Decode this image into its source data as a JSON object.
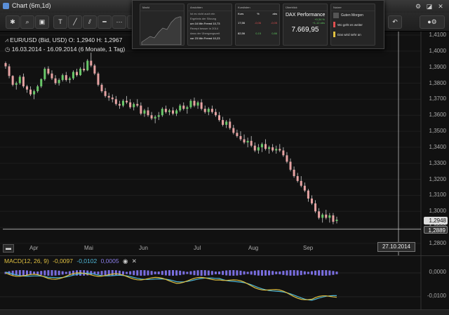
{
  "window": {
    "title": "Chart (6m,1d)"
  },
  "toolbar": {
    "buttons": [
      "settings",
      "search",
      "zoom",
      "text-tool",
      "line-tool",
      "channel-tool",
      "horizontal-line-tool",
      "dotted-line-tool",
      "pen-tool",
      "undo",
      "layout"
    ],
    "text_tool_label": "T",
    "undo_label": "↶"
  },
  "info": {
    "instrument": "EUR/USD (Bid, USD)",
    "open_label": "O: 1,2940",
    "high_label": "H: 1,2967",
    "period": "16.03.2014 - 16.09.2014 (6 Monate, 1 Tag)"
  },
  "popup": {
    "tiles": [
      {
        "title": "Markt"
      },
      {
        "title": "Ansichten",
        "lines": [
          "Ist es nicht auch ein",
          "Ergebnis der Sitzung",
          "um 16 Min Fremd 10,73",
          "Rezept besser in 2014",
          "dass der Übergangszeit",
          "vor 23 Min Fremd 10,23"
        ]
      },
      {
        "title": "Kurslisten",
        "cols": [
          "Kurs",
          "%",
          "abs"
        ],
        "rows": [
          [
            "17,56",
            "-0,06",
            "-0,05"
          ],
          [
            "82,56",
            "0,15",
            "0,86"
          ]
        ]
      },
      {
        "title": "Überblick",
        "name": "DAX Performance",
        "change1": "+0,34 %",
        "change2": "+1,12 abs",
        "value": "7.669,95"
      },
      {
        "title": "Nutzer",
        "user": "Guten Morgen",
        "items": [
          "Wo geht es weiter",
          "Das wird sehr an"
        ]
      }
    ]
  },
  "chart_data": {
    "type": "candlestick",
    "instrument": "EUR/USD (Bid, USD)",
    "ylim": [
      1.28,
      1.41
    ],
    "yticks": [
      "1,4100",
      "1,4000",
      "1,3900",
      "1,3800",
      "1,3700",
      "1,3600",
      "1,3500",
      "1,3400",
      "1,3300",
      "1,3200",
      "1,3100",
      "1,3000",
      "1,2900",
      "1,2800"
    ],
    "xticks": [
      "Apr",
      "Mai",
      "Jun",
      "Jul",
      "Aug",
      "Sep"
    ],
    "current_price": "1,2948",
    "crosshair_price": "1,2889",
    "crosshair_date": "27.10.2014",
    "candles": [
      [
        1.3925,
        1.3935,
        1.389,
        1.3905
      ],
      [
        1.3905,
        1.392,
        1.383,
        1.3845
      ],
      [
        1.3845,
        1.385,
        1.378,
        1.379
      ],
      [
        1.379,
        1.381,
        1.376,
        1.38
      ],
      [
        1.38,
        1.385,
        1.379,
        1.384
      ],
      [
        1.384,
        1.386,
        1.377,
        1.378
      ],
      [
        1.378,
        1.379,
        1.374,
        1.376
      ],
      [
        1.376,
        1.378,
        1.372,
        1.373
      ],
      [
        1.373,
        1.376,
        1.37,
        1.375
      ],
      [
        1.375,
        1.379,
        1.374,
        1.378
      ],
      [
        1.378,
        1.383,
        1.377,
        1.3825
      ],
      [
        1.3825,
        1.39,
        1.3815,
        1.389
      ],
      [
        1.389,
        1.3905,
        1.385,
        1.386
      ],
      [
        1.386,
        1.388,
        1.382,
        1.383
      ],
      [
        1.383,
        1.385,
        1.379,
        1.38
      ],
      [
        1.38,
        1.383,
        1.3785,
        1.382
      ],
      [
        1.382,
        1.386,
        1.381,
        1.385
      ],
      [
        1.385,
        1.387,
        1.381,
        1.382
      ],
      [
        1.382,
        1.384,
        1.38,
        1.383
      ],
      [
        1.383,
        1.388,
        1.382,
        1.387
      ],
      [
        1.387,
        1.389,
        1.384,
        1.385
      ],
      [
        1.385,
        1.39,
        1.3845,
        1.389
      ],
      [
        1.389,
        1.393,
        1.387,
        1.388
      ],
      [
        1.388,
        1.395,
        1.3875,
        1.394
      ],
      [
        1.394,
        1.399,
        1.39,
        1.391
      ],
      [
        1.391,
        1.392,
        1.385,
        1.386
      ],
      [
        1.386,
        1.387,
        1.378,
        1.379
      ],
      [
        1.379,
        1.38,
        1.374,
        1.375
      ],
      [
        1.375,
        1.377,
        1.371,
        1.372
      ],
      [
        1.372,
        1.374,
        1.369,
        1.371
      ],
      [
        1.371,
        1.373,
        1.368,
        1.37
      ],
      [
        1.37,
        1.372,
        1.366,
        1.367
      ],
      [
        1.367,
        1.369,
        1.364,
        1.366
      ],
      [
        1.366,
        1.37,
        1.365,
        1.369
      ],
      [
        1.369,
        1.372,
        1.367,
        1.368
      ],
      [
        1.368,
        1.37,
        1.364,
        1.365
      ],
      [
        1.365,
        1.368,
        1.363,
        1.367
      ],
      [
        1.367,
        1.37,
        1.365,
        1.366
      ],
      [
        1.366,
        1.368,
        1.36,
        1.361
      ],
      [
        1.361,
        1.364,
        1.359,
        1.363
      ],
      [
        1.363,
        1.365,
        1.359,
        1.36
      ],
      [
        1.36,
        1.362,
        1.357,
        1.358
      ],
      [
        1.358,
        1.36,
        1.355,
        1.359
      ],
      [
        1.359,
        1.362,
        1.357,
        1.36
      ],
      [
        1.36,
        1.365,
        1.359,
        1.364
      ],
      [
        1.364,
        1.366,
        1.361,
        1.362
      ],
      [
        1.362,
        1.364,
        1.36,
        1.363
      ],
      [
        1.363,
        1.365,
        1.36,
        1.361
      ],
      [
        1.361,
        1.364,
        1.3595,
        1.363
      ],
      [
        1.363,
        1.367,
        1.362,
        1.366
      ],
      [
        1.366,
        1.368,
        1.363,
        1.364
      ],
      [
        1.364,
        1.366,
        1.361,
        1.365
      ],
      [
        1.365,
        1.37,
        1.364,
        1.369
      ],
      [
        1.369,
        1.371,
        1.365,
        1.366
      ],
      [
        1.366,
        1.369,
        1.364,
        1.368
      ],
      [
        1.368,
        1.37,
        1.363,
        1.364
      ],
      [
        1.364,
        1.366,
        1.361,
        1.362
      ],
      [
        1.362,
        1.365,
        1.36,
        1.364
      ],
      [
        1.364,
        1.366,
        1.361,
        1.362
      ],
      [
        1.362,
        1.364,
        1.359,
        1.36
      ],
      [
        1.36,
        1.362,
        1.356,
        1.357
      ],
      [
        1.357,
        1.359,
        1.353,
        1.354
      ],
      [
        1.354,
        1.357,
        1.352,
        1.356
      ],
      [
        1.356,
        1.358,
        1.351,
        1.352
      ],
      [
        1.352,
        1.354,
        1.348,
        1.349
      ],
      [
        1.349,
        1.351,
        1.346,
        1.347
      ],
      [
        1.347,
        1.35,
        1.344,
        1.345
      ],
      [
        1.345,
        1.348,
        1.342,
        1.343
      ],
      [
        1.343,
        1.346,
        1.34,
        1.344
      ],
      [
        1.344,
        1.347,
        1.34,
        1.341
      ],
      [
        1.341,
        1.343,
        1.337,
        1.338
      ],
      [
        1.338,
        1.342,
        1.336,
        1.34
      ],
      [
        1.34,
        1.343,
        1.337,
        1.342
      ],
      [
        1.342,
        1.345,
        1.338,
        1.339
      ],
      [
        1.339,
        1.341,
        1.336,
        1.34
      ],
      [
        1.34,
        1.342,
        1.337,
        1.338
      ],
      [
        1.338,
        1.341,
        1.336,
        1.339
      ],
      [
        1.339,
        1.342,
        1.337,
        1.338
      ],
      [
        1.338,
        1.34,
        1.334,
        1.335
      ],
      [
        1.335,
        1.337,
        1.33,
        1.331
      ],
      [
        1.331,
        1.333,
        1.325,
        1.326
      ],
      [
        1.326,
        1.328,
        1.321,
        1.322
      ],
      [
        1.322,
        1.324,
        1.318,
        1.319
      ],
      [
        1.319,
        1.322,
        1.315,
        1.316
      ],
      [
        1.316,
        1.318,
        1.312,
        1.313
      ],
      [
        1.313,
        1.314,
        1.306,
        1.308
      ],
      [
        1.308,
        1.31,
        1.304,
        1.305
      ],
      [
        1.305,
        1.307,
        1.299,
        1.3
      ],
      [
        1.3,
        1.302,
        1.295,
        1.296
      ],
      [
        1.296,
        1.299,
        1.293,
        1.298
      ],
      [
        1.298,
        1.301,
        1.295,
        1.296
      ],
      [
        1.296,
        1.299,
        1.293,
        1.2975
      ],
      [
        1.2975,
        1.299,
        1.292,
        1.2935
      ],
      [
        1.294,
        1.2967,
        1.2925,
        1.2948
      ]
    ]
  },
  "macd": {
    "label": "MACD(12, 26, 9)",
    "value1": "-0,0097",
    "value2": "-0,0102",
    "value3": "0,0005",
    "yticks": [
      "0,0000",
      "-0,0100"
    ]
  }
}
